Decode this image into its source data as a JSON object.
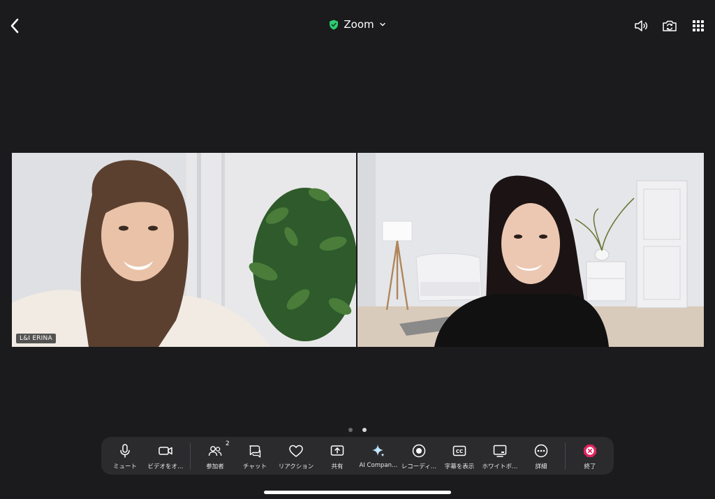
{
  "header": {
    "title": "Zoom",
    "icons": [
      "back-chevron-icon",
      "shield-check-icon",
      "chevron-down-icon",
      "speaker-icon",
      "camera-flip-icon",
      "grid-icon"
    ],
    "accent_color": "#2ecc71"
  },
  "participants": [
    {
      "name": "L&I ERINA"
    },
    {
      "name": ""
    }
  ],
  "pager": {
    "current": 2,
    "total": 2
  },
  "toolbar": {
    "mute": "ミュート",
    "video": "ビデオをオ…",
    "participants": "参加者",
    "participants_count": "2",
    "chat": "チャット",
    "reactions": "リアクション",
    "share": "共有",
    "ai_companion": "AI Compan…",
    "record": "レコーディ…",
    "captions": "字幕を表示",
    "whiteboard": "ホワイトボ…",
    "more": "詳細",
    "end": "終了",
    "end_color": "#e0245e"
  }
}
